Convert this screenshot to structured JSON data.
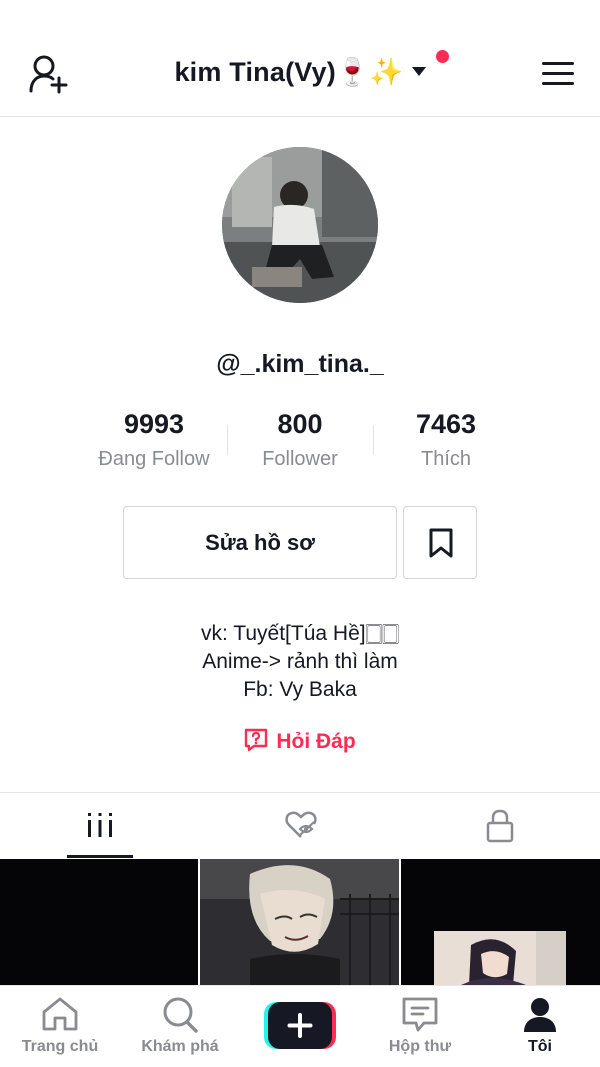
{
  "header": {
    "title": "kim Tina(Vy)🍷✨",
    "add_friend_icon": "person-plus-icon",
    "menu_icon": "hamburger-menu-icon"
  },
  "profile": {
    "username": "@_.kim_tina._",
    "stats": [
      {
        "value": "9993",
        "label": "Đang Follow"
      },
      {
        "value": "800",
        "label": "Follower"
      },
      {
        "value": "7463",
        "label": "Thích"
      }
    ],
    "edit_label": "Sửa hồ sơ",
    "bio": [
      "vk: Tuyết[Túa Hề]🀆🀆",
      "Anime-> rảnh thì làm",
      "Fb: Vy Baka"
    ],
    "qa_label": "Hỏi Đáp"
  },
  "tabs": [
    "videos-grid-icon",
    "liked-hidden-icon",
    "lock-icon"
  ],
  "nav": [
    {
      "label": "Trang chủ",
      "icon": "home-icon"
    },
    {
      "label": "Khám phá",
      "icon": "search-icon"
    },
    {
      "label": "",
      "icon": "create-plus-icon"
    },
    {
      "label": "Hộp thư",
      "icon": "inbox-icon"
    },
    {
      "label": "Tôi",
      "icon": "profile-icon"
    }
  ],
  "colors": {
    "accent": "#fe2c55",
    "text": "#161823",
    "muted": "#8a8b91",
    "plus_cyan": "#25f4ee"
  }
}
